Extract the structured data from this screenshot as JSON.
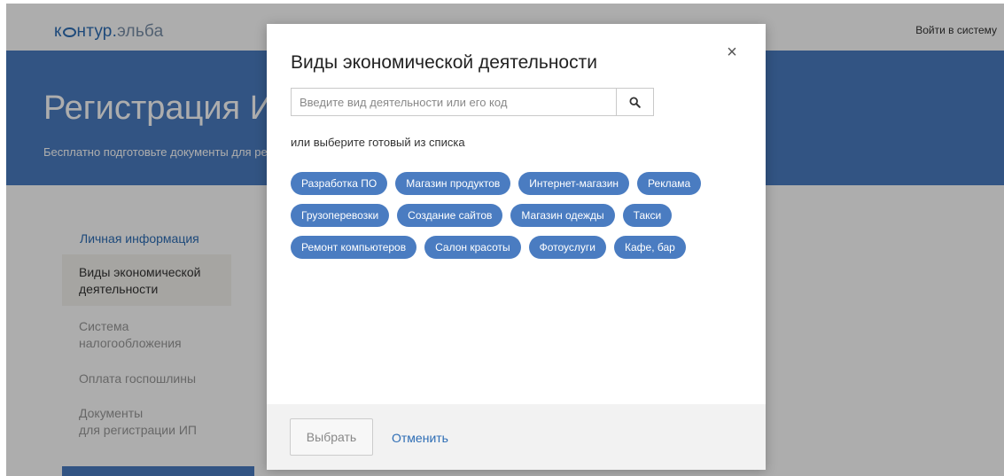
{
  "header": {
    "logo_k": "к",
    "logo_main": "нтур",
    "logo_dot": ".",
    "logo_brand": "эльба",
    "login_label": "Войти в систему"
  },
  "hero": {
    "title": "Регистрация ИП",
    "subtitle": "Бесплатно подготовьте документы для регистрации ИП"
  },
  "steps": {
    "personal": "Личная информация",
    "activity": "Виды экономической деятельности",
    "tax": "Система налогообложения",
    "fee": "Оплата госпошлины",
    "docs_line1": "Документы",
    "docs_line2": "для регистрации ИП"
  },
  "modal": {
    "title": "Виды экономической деятельности",
    "close_symbol": "×",
    "search_placeholder": "Введите вид деятельности или его код",
    "search_value": "",
    "choose_label": "или выберите готовый из списка",
    "tag_rows": [
      [
        "Разработка ПО",
        "Магазин продуктов",
        "Интернет-магазин",
        "Реклама"
      ],
      [
        "Грузоперевозки",
        "Создание сайтов",
        "Магазин одежды",
        "Такси"
      ],
      [
        "Ремонт компьютеров",
        "Салон красоты",
        "Фотоуслуги",
        "Кафе, бар"
      ]
    ],
    "select_label": "Выбрать",
    "cancel_label": "Отменить"
  },
  "colors": {
    "accent": "#4a7cc1",
    "link": "#2d6db5"
  },
  "icons": {
    "search": "search-icon",
    "close": "close-icon"
  }
}
